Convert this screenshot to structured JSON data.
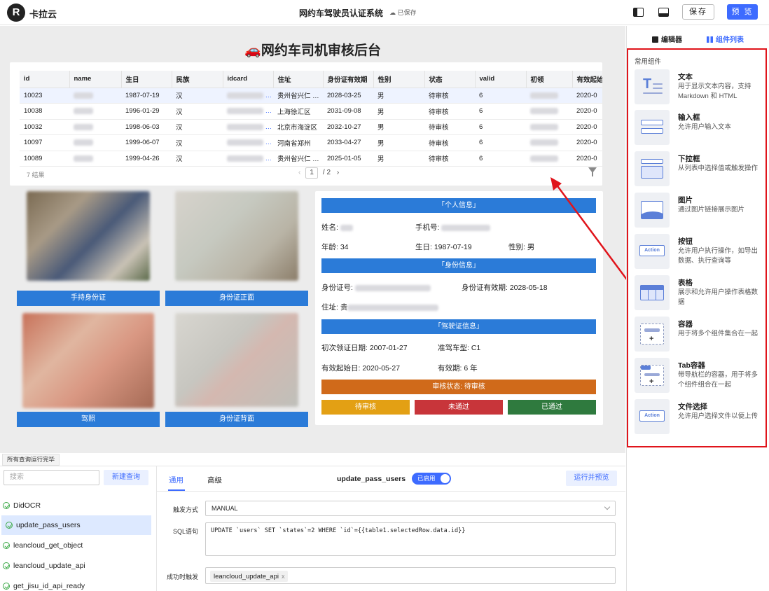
{
  "header": {
    "brand": "卡拉云",
    "app_title": "网约车驾驶员认证系统",
    "save_status": "已保存",
    "save_label": "保存",
    "preview_label": "预 览"
  },
  "canvas": {
    "heading": "🚗网约车司机审核后台",
    "table": {
      "columns": [
        "id",
        "name",
        "生日",
        "民族",
        "idcard",
        "住址",
        "身份证有效期",
        "性别",
        "状态",
        "valid",
        "初领",
        "有效起始"
      ],
      "rows": [
        [
          "10023",
          "",
          "1987-07-19",
          "汉",
          "",
          "贵州省兴仁 …",
          "2028-03-25",
          "男",
          "待审核",
          "6",
          "",
          "2020-0"
        ],
        [
          "10038",
          "",
          "1996-01-29",
          "汉",
          "",
          "上海徐汇区",
          "2031-09-08",
          "男",
          "待审核",
          "6",
          "",
          "2020-0"
        ],
        [
          "10032",
          "",
          "1998-06-03",
          "汉",
          "",
          "北京市海淀区",
          "2032-10-27",
          "男",
          "待审核",
          "6",
          "",
          "2020-0"
        ],
        [
          "10097",
          "",
          "1999-06-07",
          "汉",
          "",
          "河南省郑州",
          "2033-04-27",
          "男",
          "待审核",
          "6",
          "",
          "2020-0"
        ],
        [
          "10089",
          "",
          "1999-04-26",
          "汉",
          "",
          "贵州省兴仁 …",
          "2025-01-05",
          "男",
          "待审核",
          "6",
          "",
          "2020-0"
        ]
      ],
      "result_count": "7 结果",
      "page_current": "1",
      "page_total": "/ 2"
    },
    "photos": {
      "hold_id_label": "手持身份证",
      "id_front_label": "身份证正面",
      "license_label": "驾照",
      "id_back_label": "身份证背面"
    },
    "info": {
      "personal_header": "「个人信息」",
      "name_label": "姓名:",
      "phone_label": "手机号:",
      "age_label": "年龄: 34",
      "birthday_label": "生日: 1987-07-19",
      "gender_label": "性别: 男",
      "id_header": "「身份信息」",
      "id_number_label": "身份证号:",
      "id_valid_label": "身份证有效期: 2028-05-18",
      "address_label": "住址: 贵",
      "license_header": "「驾驶证信息」",
      "first_issue_label": "初次领证日期: 2007-01-27",
      "vehicle_type_label": "准驾车型: C1",
      "valid_start_label": "有效起始日: 2020-05-27",
      "valid_period_label": "有效期: 6 年",
      "status_label": "审核状态: 待审核",
      "btn_pending": "待审核",
      "btn_rejected": "未通过",
      "btn_passed": "已通过"
    }
  },
  "bottom": {
    "run_status": "所有查询运行完毕",
    "search_placeholder": "搜索",
    "new_query": "新建查询",
    "queries": [
      "DidOCR",
      "update_pass_users",
      "leancloud_get_object",
      "leancloud_update_api",
      "get_jisu_id_api_ready"
    ],
    "tab_general": "通用",
    "tab_advanced": "高级",
    "query_name": "update_pass_users",
    "toggle_label": "已启用",
    "run_preview": "运行并预览",
    "trigger_label": "触发方式",
    "trigger_value": "MANUAL",
    "sql_label": "SQL语句",
    "sql_value": "UPDATE `users` SET `states`=2 WHERE `id`={{table1.selectedRow.data.id}}",
    "on_success_label": "成功时触发",
    "on_success_tag": "leancloud_update_api",
    "tag_remove": "x"
  },
  "right_panel": {
    "tab_editor": "编辑器",
    "tab_components": "组件列表",
    "section_title": "常用组件",
    "components": [
      {
        "title": "文本",
        "desc": "用于显示文本内容，支持 Markdown 和 HTML"
      },
      {
        "title": "输入框",
        "desc": "允许用户输入文本"
      },
      {
        "title": "下拉框",
        "desc": "从列表中选择值或触发操作"
      },
      {
        "title": "图片",
        "desc": "通过图片链接展示图片"
      },
      {
        "title": "按钮",
        "desc": "允许用户执行操作，如导出数据、执行查询等"
      },
      {
        "title": "表格",
        "desc": "展示和允许用户操作表格数据"
      },
      {
        "title": "容器",
        "desc": "用于将多个组件集合在一起"
      },
      {
        "title": "Tab容器",
        "desc": "带导航栏的容器，用于将多个组件组合在一起"
      },
      {
        "title": "文件选择",
        "desc": "允许用户选择文件以便上传"
      }
    ],
    "action_label": "Action"
  },
  "colors": {
    "accent": "#3d6bff",
    "section_blue": "#2b7bd8",
    "status_orange": "#d06a1a",
    "btn_pending": "#e3a014",
    "btn_rejected": "#c8353a",
    "btn_passed": "#2f7a3e",
    "highlight_red": "#e0141b"
  }
}
